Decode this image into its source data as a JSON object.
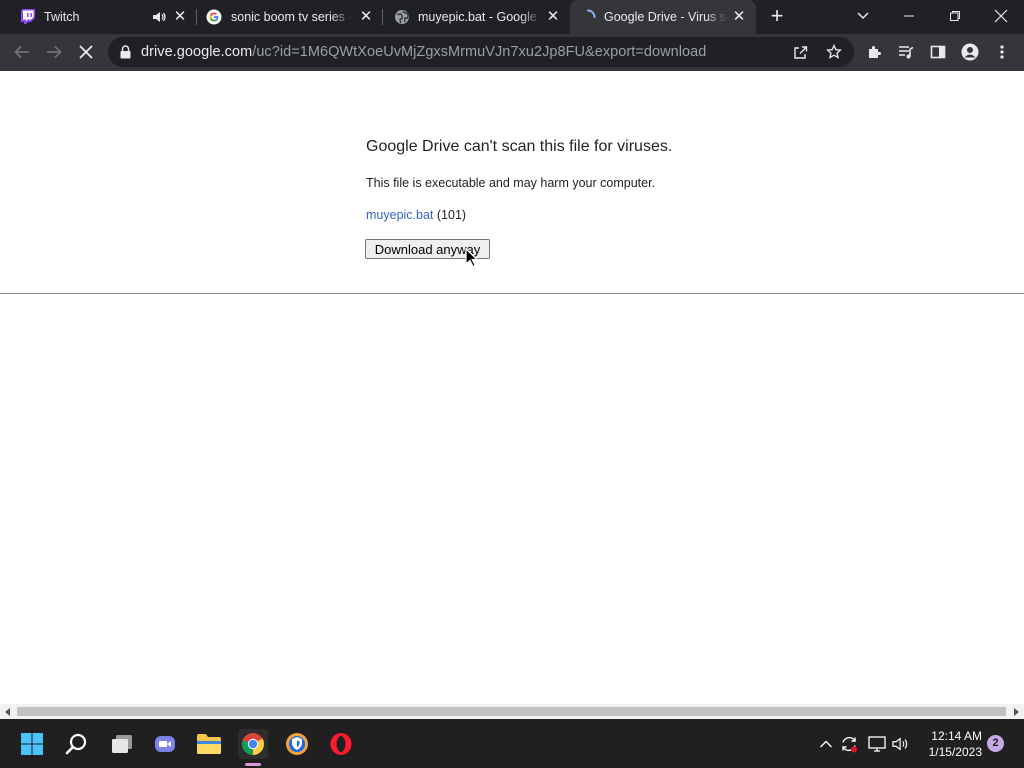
{
  "browser": {
    "tabs": [
      {
        "title": "Twitch",
        "favicon": "twitch-icon",
        "audio": true,
        "active": false
      },
      {
        "title": "sonic boom tv series - Google Search",
        "favicon": "google-icon",
        "audio": false,
        "active": false
      },
      {
        "title": "muyepic.bat - Google Drive",
        "favicon": "globe-icon",
        "audio": false,
        "active": false
      },
      {
        "title": "Google Drive - Virus scan warning",
        "favicon": "loading-icon",
        "audio": false,
        "active": true
      }
    ],
    "address": {
      "host": "drive.google.com",
      "path": "/uc?id=1M6QWtXoeUvMjZgxsMrmuVJn7xu2Jp8FU&export=download"
    }
  },
  "page": {
    "title": "Google Drive can't scan this file for viruses.",
    "message": "This file is executable and may harm your computer.",
    "file_name": "muyepic.bat",
    "file_size": "(101)",
    "download_label": "Download anyway"
  },
  "taskbar": {
    "time": "12:14 AM",
    "date": "1/15/2023",
    "notification_count": "2"
  },
  "colors": {
    "tabstrip": "#202124",
    "toolbar": "#35363a",
    "link": "#3366cc",
    "taskbar": "#202020",
    "twitch": "#9146ff",
    "opera": "#ff1b2d"
  }
}
